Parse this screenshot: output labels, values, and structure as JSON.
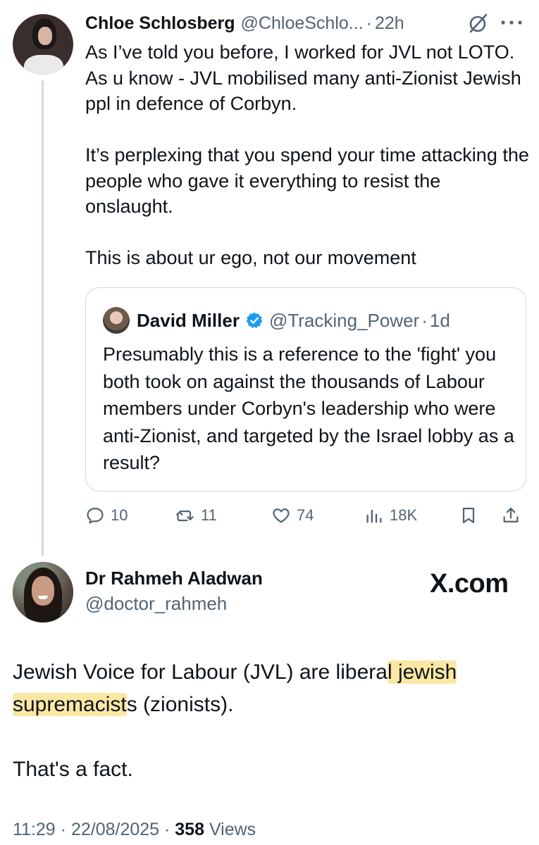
{
  "tweet1": {
    "name": "Chloe Schlosberg",
    "handle": "@ChloeSchlo...",
    "dot": "·",
    "time": "22h",
    "body_text": "As I’ve told you before, I worked for JVL not LOTO. As u know - JVL mobilised many anti-Zionist Jewish ppl in defence of Corbyn.\n\nIt’s perplexing that you spend your time attacking the people who gave it everything to resist the onslaught.\n\nThis is about ur ego, not our movement",
    "quote": {
      "name": "David Miller",
      "handle": "@Tracking_Power",
      "dot": "·",
      "time": "1d",
      "body_text": "Presumably this is a reference to the 'fight' you both took on against the thousands of Labour members under Corbyn's leadership who were anti-Zionist, and targeted by the Israel lobby as a result?"
    },
    "actions": {
      "replies": "10",
      "reposts": "11",
      "likes": "74",
      "views": "18K"
    }
  },
  "tweet2": {
    "name": "Dr Rahmeh Aladwan",
    "handle": "@doctor_rahmeh",
    "watermark": "X.com",
    "body_part1": "Jewish Voice for Labour (JVL) are libera",
    "body_highlight1": "l jewish",
    "body_break": "\n",
    "body_highlight2": "supremacist",
    "body_part2": "s (zionists).\n\nThat's a fact.",
    "meta_time": "11:29",
    "meta_sep1": " · ",
    "meta_date": "22/08/2025",
    "meta_sep2": " · ",
    "meta_views_count": "358",
    "meta_views_label": " Views"
  },
  "icons": {
    "verified_color": "#1d9bf0",
    "highlight_color": "#fbe7a3"
  }
}
